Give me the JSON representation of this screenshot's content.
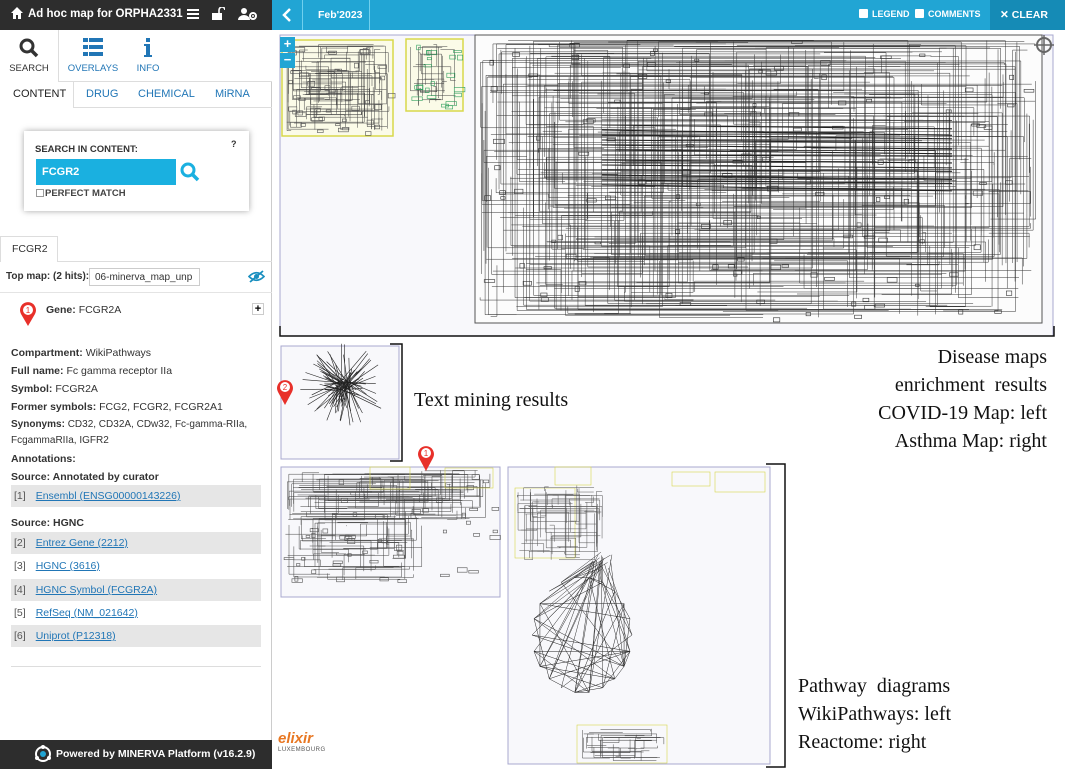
{
  "header": {
    "app_title": "Ad hoc map for ORPHA2331",
    "icons": [
      "home-icon",
      "menu-icon",
      "unlock-icon",
      "user-settings-icon"
    ]
  },
  "main_tabs": [
    {
      "label": "SEARCH",
      "icon": "search-icon"
    },
    {
      "label": "OVERLAYS",
      "icon": "overlays-icon"
    },
    {
      "label": "INFO",
      "icon": "info-icon"
    }
  ],
  "sub_tabs": [
    "CONTENT",
    "DRUG",
    "CHEMICAL",
    "MiRNA"
  ],
  "search": {
    "label": "SEARCH IN CONTENT:",
    "help": "?",
    "value": "FCGR2",
    "perfect_match": "PERFECT MATCH"
  },
  "result_tab": "FCGR2",
  "top_map": {
    "label": "Top map: (2 hits):",
    "value": "06-minerva_map_unp"
  },
  "gene": {
    "marker": "1",
    "label": "Gene:",
    "name": "FCGR2A",
    "fields": [
      {
        "key": "Compartment:",
        "value": "WikiPathways"
      },
      {
        "key": "Full name:",
        "value": "Fc gamma receptor IIa"
      },
      {
        "key": "Symbol:",
        "value": "FCGR2A"
      },
      {
        "key": "Former symbols:",
        "value": "FCG2, FCGR2, FCGR2A1"
      },
      {
        "key": "Synonyms:",
        "value": "CD32, CD32A, CDw32, Fc-gamma-RIIa, FcgammaRIIa, IGFR2"
      },
      {
        "key": "Annotations:",
        "value": ""
      }
    ],
    "source_curator": "Source: Annotated by curator",
    "source_hgnc": "Source: HGNC",
    "annotations": [
      {
        "idx": "[1]",
        "text": "Ensembl (ENSG00000143226)"
      },
      {
        "idx": "[2]",
        "text": "Entrez Gene (2212)"
      },
      {
        "idx": "[3]",
        "text": "HGNC (3616)"
      },
      {
        "idx": "[4]",
        "text": "HGNC Symbol (FCGR2A)"
      },
      {
        "idx": "[5]",
        "text": "RefSeq (NM_021642)"
      },
      {
        "idx": "[6]",
        "text": "Uniprot (P12318)"
      }
    ]
  },
  "footer": "Powered by MINERVA Platform (v16.2.9)",
  "map_bar": {
    "version": "Feb'2023",
    "legend": "LEGEND",
    "comments": "COMMENTS",
    "clear": "CLEAR"
  },
  "map_markers": [
    "2",
    "1"
  ],
  "annotations_text": {
    "disease_maps": [
      "Disease maps",
      "enrichment  results",
      "COVID-19 Map: left",
      "Asthma Map: right"
    ],
    "text_mining": "Text mining results",
    "pathway": [
      "Pathway  diagrams",
      "WikiPathways: left",
      "Reactome: right"
    ]
  },
  "logo": {
    "text": "elixir",
    "subtext": "LUXEMBOURG"
  },
  "colors": {
    "topbar": "#2d2d2d",
    "accent": "#21a5d4",
    "link": "#2176b6",
    "marker": "#e8302a"
  }
}
